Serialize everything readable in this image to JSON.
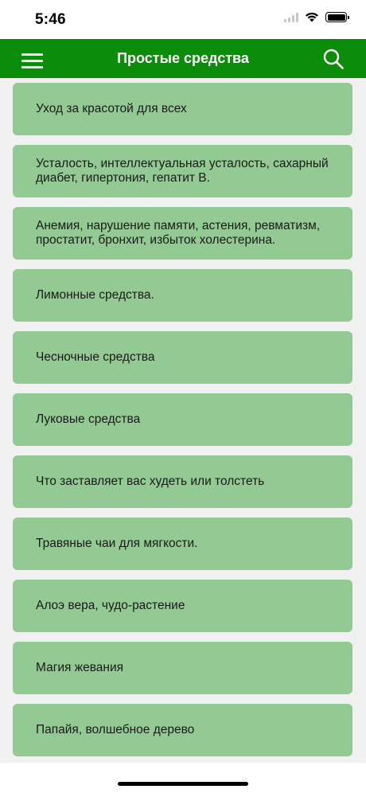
{
  "status_bar": {
    "time": "5:46"
  },
  "header": {
    "title": "Простые средства",
    "menu_icon": "hamburger-menu-icon",
    "search_icon": "search-icon",
    "background_color": "#0b8c0b"
  },
  "list": {
    "item_color": "#93c993",
    "items": [
      {
        "label": "Уход за красотой для всех"
      },
      {
        "label": "Усталость, интеллектуальная усталость, сахарный диабет, гипертония, гепатит В."
      },
      {
        "label": "Анемия, нарушение памяти, астения, ревматизм, простатит, бронхит, избыток холестерина."
      },
      {
        "label": "Лимонные средства."
      },
      {
        "label": "Чесночные средства"
      },
      {
        "label": "Луковые средства"
      },
      {
        "label": "Что заставляет вас худеть или толстеть"
      },
      {
        "label": "Травяные чаи для мягкости."
      },
      {
        "label": "Алоэ вера, чудо-растение"
      },
      {
        "label": "Магия жевания"
      },
      {
        "label": "Папайя, волшебное дерево"
      }
    ]
  }
}
